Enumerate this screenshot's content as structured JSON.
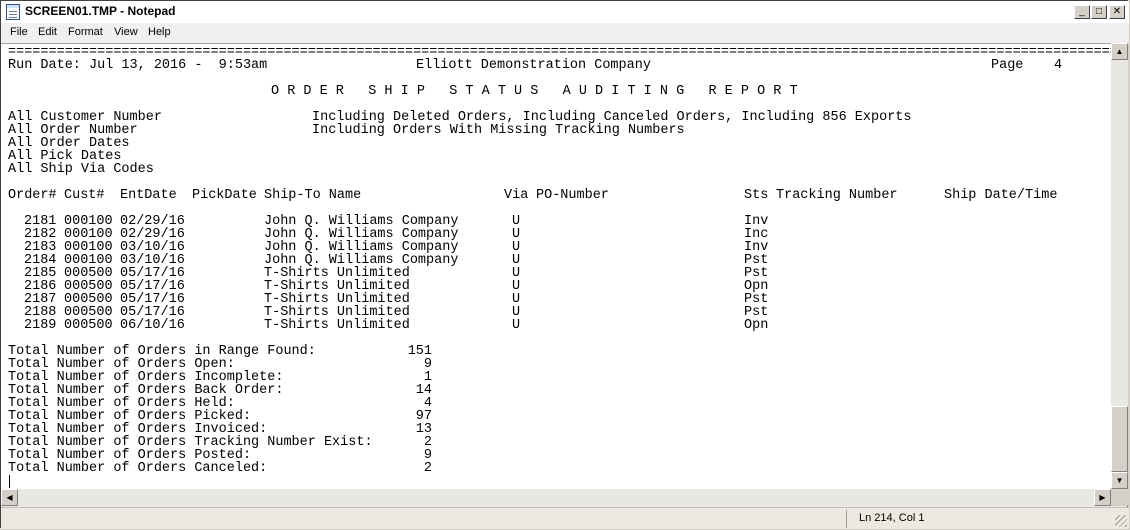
{
  "window": {
    "title": "SCREEN01.TMP - Notepad",
    "controls": {
      "minimize": "_",
      "maximize": "□",
      "close": "✕"
    }
  },
  "menu": [
    "File",
    "Edit",
    "Format",
    "View",
    "Help"
  ],
  "editor": {
    "separator": "=============================================================================================================================================",
    "header": {
      "run_date": "Run Date: Jul 13, 2016 -  9:53am",
      "company": "Elliott Demonstration Company",
      "page_label": "Page",
      "page_number": "4",
      "title": "O R D E R   S H I P   S T A T U S   A U D I T I N G   R E P O R T"
    },
    "criteria": [
      "All Customer Number",
      "All Order Number",
      "All Order Dates",
      "All Pick Dates",
      "All Ship Via Codes"
    ],
    "options": [
      "Including Deleted Orders, Including Canceled Orders, Including 856 Exports",
      "Including Orders With Missing Tracking Numbers"
    ],
    "columns": {
      "order": "Order#",
      "cust": "Cust#",
      "entdate": "EntDate",
      "pickdate": "PickDate",
      "shipto": "Ship-To Name",
      "via": "Via",
      "po": "PO-Number",
      "sts": "Sts",
      "tracking": "Tracking Number",
      "shipdate": "Ship Date/Time"
    },
    "rows": [
      {
        "order": "2181",
        "cust": "000100",
        "entdate": "02/29/16",
        "shipto": "John Q. Williams Company",
        "via": "U",
        "sts": "Inv"
      },
      {
        "order": "2182",
        "cust": "000100",
        "entdate": "02/29/16",
        "shipto": "John Q. Williams Company",
        "via": "U",
        "sts": "Inc"
      },
      {
        "order": "2183",
        "cust": "000100",
        "entdate": "03/10/16",
        "shipto": "John Q. Williams Company",
        "via": "U",
        "sts": "Inv"
      },
      {
        "order": "2184",
        "cust": "000100",
        "entdate": "03/10/16",
        "shipto": "John Q. Williams Company",
        "via": "U",
        "sts": "Pst"
      },
      {
        "order": "2185",
        "cust": "000500",
        "entdate": "05/17/16",
        "shipto": "T-Shirts Unlimited",
        "via": "U",
        "sts": "Pst"
      },
      {
        "order": "2186",
        "cust": "000500",
        "entdate": "05/17/16",
        "shipto": "T-Shirts Unlimited",
        "via": "U",
        "sts": "Opn"
      },
      {
        "order": "2187",
        "cust": "000500",
        "entdate": "05/17/16",
        "shipto": "T-Shirts Unlimited",
        "via": "U",
        "sts": "Pst"
      },
      {
        "order": "2188",
        "cust": "000500",
        "entdate": "05/17/16",
        "shipto": "T-Shirts Unlimited",
        "via": "U",
        "sts": "Pst"
      },
      {
        "order": "2189",
        "cust": "000500",
        "entdate": "06/10/16",
        "shipto": "T-Shirts Unlimited",
        "via": "U",
        "sts": "Opn"
      }
    ],
    "totals": [
      {
        "label": "Total Number of Orders in Range Found:",
        "value": "151"
      },
      {
        "label": "Total Number of Orders Open:",
        "value": "9"
      },
      {
        "label": "Total Number of Orders Incomplete:",
        "value": "1"
      },
      {
        "label": "Total Number of Orders Back Order:",
        "value": "14"
      },
      {
        "label": "Total Number of Orders Held:",
        "value": "4"
      },
      {
        "label": "Total Number of Orders Picked:",
        "value": "97"
      },
      {
        "label": "Total Number of Orders Invoiced:",
        "value": "13"
      },
      {
        "label": "Total Number of Orders Tracking Number Exist:",
        "value": "2"
      },
      {
        "label": "Total Number of Orders Posted:",
        "value": "9"
      },
      {
        "label": "Total Number of Orders Canceled:",
        "value": "2"
      }
    ]
  },
  "scrollbars": {
    "up": "▲",
    "down": "▼",
    "left": "◀",
    "right": "▶"
  },
  "status": {
    "position": "Ln 214, Col 1"
  }
}
